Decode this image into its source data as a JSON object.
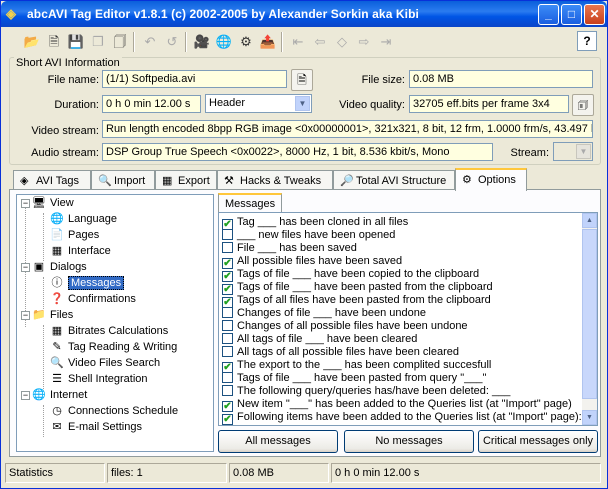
{
  "window": {
    "title": "abcAVI Tag Editor v1.8.1 (c) 2002-2005 by Alexander Sorkin aka Kibi"
  },
  "group": {
    "title": "Short AVI Information"
  },
  "fields": {
    "file_name_label": "File name:",
    "file_name_value": "(1/1) Softpedia.avi",
    "file_size_label": "File size:",
    "file_size_value": "0.08 MB",
    "duration_label": "Duration:",
    "duration_value": "0 h 0 min 12.00 s",
    "header_select": "Header",
    "video_quality_label": "Video quality:",
    "video_quality_value": "32705 eff.bits per frame 3x4",
    "video_stream_label": "Video stream:",
    "video_stream_value": "Run length encoded 8bpp RGB image <0x00000001>, 321x321, 8 bit, 12 frm, 1.0000 frm/s, 43.497 kbit",
    "audio_stream_label": "Audio stream:",
    "audio_stream_value": "DSP Group True Speech <0x0022>, 8000 Hz, 1 bit, 8.536 kbit/s, Mono",
    "stream_label": "Stream:",
    "stream_value": ""
  },
  "tabs": [
    {
      "label": "AVI Tags"
    },
    {
      "label": "Import"
    },
    {
      "label": "Export"
    },
    {
      "label": "Hacks & Tweaks"
    },
    {
      "label": "Total AVI Structure"
    },
    {
      "label": "Options"
    }
  ],
  "tree": [
    {
      "label": "View",
      "icon": "monitor-icon"
    },
    {
      "label": "Language",
      "icon": "globe-icon"
    },
    {
      "label": "Pages",
      "icon": "page-icon"
    },
    {
      "label": "Interface",
      "icon": "interface-icon"
    },
    {
      "label": "Dialogs",
      "icon": "dialog-icon"
    },
    {
      "label": "Messages",
      "icon": "info-icon"
    },
    {
      "label": "Confirmations",
      "icon": "question-icon"
    },
    {
      "label": "Files",
      "icon": "folder-icon"
    },
    {
      "label": "Bitrates Calculations",
      "icon": "calculator-icon"
    },
    {
      "label": "Tag Reading & Writing",
      "icon": "pen-icon"
    },
    {
      "label": "Video Files Search",
      "icon": "search-icon"
    },
    {
      "label": "Shell Integration",
      "icon": "shell-icon"
    },
    {
      "label": "Internet",
      "icon": "internet-icon"
    },
    {
      "label": "Connections Schedule",
      "icon": "schedule-icon"
    },
    {
      "label": "E-mail Settings",
      "icon": "mail-icon"
    }
  ],
  "messages_tab": {
    "label": "Messages"
  },
  "messages": [
    {
      "text": "Tag ___ has been cloned in all files",
      "checked": true
    },
    {
      "text": "___ new files have been opened",
      "checked": false
    },
    {
      "text": "File ___ has been saved",
      "checked": false
    },
    {
      "text": "All possible files have been saved",
      "checked": true
    },
    {
      "text": "Tags of file ___ have been copied to the clipboard",
      "checked": true
    },
    {
      "text": "Tags of file ___ have been pasted from the clipboard",
      "checked": true
    },
    {
      "text": "Tags of all files have been pasted from the clipboard",
      "checked": true
    },
    {
      "text": "Changes of file ___ have been undone",
      "checked": false
    },
    {
      "text": "Changes of all possible files have been undone",
      "checked": false
    },
    {
      "text": "All tags of file ___ have been cleared",
      "checked": false
    },
    {
      "text": "All tags of all possible files have been cleared",
      "checked": false
    },
    {
      "text": "The export to the ___ has been complited succesfull",
      "checked": true
    },
    {
      "text": "Tags of file ___ have been pasted from query \"___\"",
      "checked": false
    },
    {
      "text": "The following query/queries has/have been deleted: ___",
      "checked": false
    },
    {
      "text": "New item \"___\" has been added to the Queries list (at \"Import\" page)",
      "checked": true
    },
    {
      "text": "Following items have been added to the Queries list (at \"Import\" page):",
      "checked": true
    }
  ],
  "buttons": {
    "all": "All messages",
    "none": "No messages",
    "critical": "Critical messages only"
  },
  "status": {
    "label": "Statistics",
    "files": "files: 1",
    "size": "0.08 MB",
    "duration": "0 h 0 min 12.00 s"
  }
}
